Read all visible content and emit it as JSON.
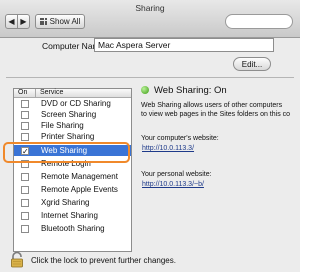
{
  "window": {
    "title": "Sharing"
  },
  "toolbar": {
    "back_label": "◀",
    "forward_label": "▶",
    "show_all_label": "Show All",
    "search_placeholder": ""
  },
  "computer_name": {
    "label": "Computer Name:",
    "value": "Mac Aspera Server",
    "edit_label": "Edit..."
  },
  "services": {
    "header_on": "On",
    "header_service": "Service",
    "items": [
      {
        "label": "DVD or CD Sharing",
        "checked": false
      },
      {
        "label": "Screen Sharing",
        "checked": false
      },
      {
        "label": "File Sharing",
        "checked": false
      },
      {
        "label": "Printer Sharing",
        "checked": false
      },
      {
        "label": "Web Sharing",
        "checked": true,
        "selected": true
      },
      {
        "label": "Remote Login",
        "checked": false
      },
      {
        "label": "Remote Management",
        "checked": false
      },
      {
        "label": "Remote Apple Events",
        "checked": false
      },
      {
        "label": "Xgrid Sharing",
        "checked": false
      },
      {
        "label": "Internet Sharing",
        "checked": false
      },
      {
        "label": "Bluetooth Sharing",
        "checked": false
      }
    ]
  },
  "detail": {
    "status": "Web Sharing: On",
    "description_line1": "Web Sharing allows users of other computers",
    "description_line2": "to view web pages in the Sites folders on this co",
    "computer_site_label": "Your computer's website:",
    "computer_site_url": "http://10.0.113.3/",
    "personal_site_label": "Your personal website:",
    "personal_site_url": "http://10.0.113.3/~b/"
  },
  "lock": {
    "text": "Click the lock to prevent further changes."
  },
  "colors": {
    "selection": "#3a74d6",
    "highlight_ring": "#f0892b",
    "status_on": "#3c9b12",
    "link": "#1e3a8a"
  }
}
